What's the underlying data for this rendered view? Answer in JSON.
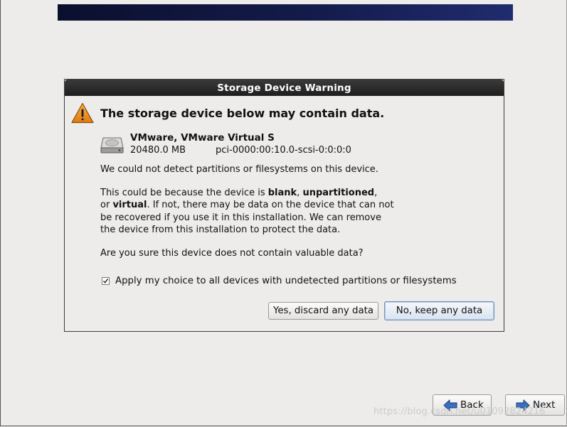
{
  "dialog": {
    "title": "Storage Device Warning",
    "headline": "The storage device below may contain data.",
    "device": {
      "name": "VMware, VMware Virtual S",
      "size": "20480.0 MB",
      "path": "pci-0000:00:10.0-scsi-0:0:0:0",
      "icon": "hard-disk-icon"
    },
    "paragraph1": "We could not detect partitions or filesystems on this device.",
    "paragraph2": {
      "part1": "This could be because the device is ",
      "blank": "blank",
      "sep1": ", ",
      "unpartitioned": "unpartitioned",
      "sep2": ",",
      "part2": "or ",
      "virtual": "virtual",
      "part3": ". If not, there may be data on the device that can not be recovered if you use it in this installation. We can remove the device from this installation to protect the data."
    },
    "paragraph3": "Are you sure this device does not contain valuable data?",
    "apply_all": {
      "label": "Apply my choice to all devices with undetected partitions or filesystems",
      "checked": true
    },
    "buttons": {
      "discard": "Yes, discard any data",
      "keep": "No, keep any data"
    },
    "warning_icon": "warning-icon"
  },
  "navigation": {
    "back": "Back",
    "next": "Next"
  },
  "watermark": "https://blog.csdn.net/u01092824216",
  "colors": {
    "banner": "#141b4a",
    "titlebar": "#2b2b2b",
    "background": "#edeceb",
    "warning": "#e8891d",
    "arrow": "#2e5fa8"
  }
}
